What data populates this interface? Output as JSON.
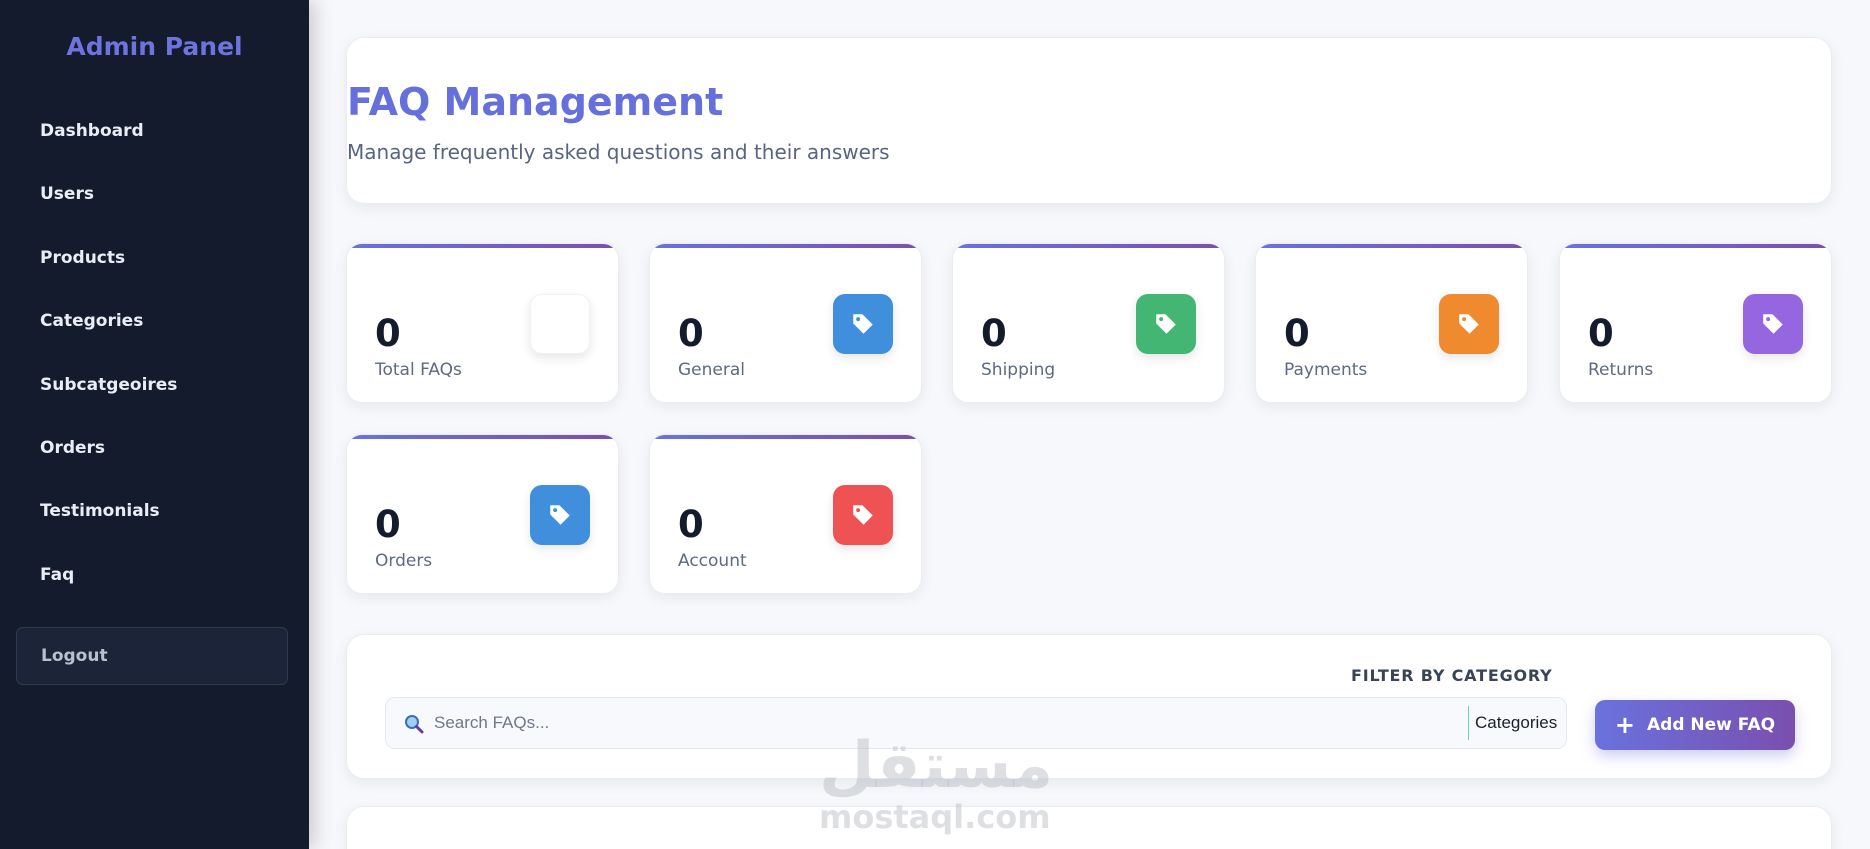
{
  "sidebar": {
    "brand": "Admin Panel",
    "items": [
      {
        "label": "Dashboard"
      },
      {
        "label": "Users"
      },
      {
        "label": "Products"
      },
      {
        "label": "Categories"
      },
      {
        "label": "Subcatgeoires"
      },
      {
        "label": "Orders"
      },
      {
        "label": "Testimonials"
      },
      {
        "label": "Faq"
      }
    ],
    "logout": "Logout"
  },
  "header": {
    "title": "FAQ Management",
    "subtitle": "Manage frequently asked questions and their answers"
  },
  "stats": [
    {
      "value": "0",
      "label": "Total FAQs",
      "icon": "blank-icon",
      "color": "#ffffff"
    },
    {
      "value": "0",
      "label": "General",
      "icon": "tag-icon",
      "color": "#3f8fdc"
    },
    {
      "value": "0",
      "label": "Shipping",
      "icon": "tag-icon",
      "color": "#44b673"
    },
    {
      "value": "0",
      "label": "Payments",
      "icon": "tag-icon",
      "color": "#ef8a2e"
    },
    {
      "value": "0",
      "label": "Returns",
      "icon": "tag-icon",
      "color": "#9566e0"
    },
    {
      "value": "0",
      "label": "Orders",
      "icon": "tag-icon",
      "color": "#3f8fdc"
    },
    {
      "value": "0",
      "label": "Account",
      "icon": "tag-icon",
      "color": "#ee5253"
    }
  ],
  "filter": {
    "label": "FILTER BY CATEGORY",
    "search_placeholder": "Search FAQs...",
    "category_selected": "Categories",
    "add_button": "Add New FAQ"
  },
  "watermark": {
    "arabic": "مستقل",
    "latin": "mostaql.com"
  },
  "colors": {
    "accent": "#6670dc",
    "sidebar_bg": "#141b2d",
    "gradient_start": "#6a72de",
    "gradient_end": "#7a4fae"
  }
}
